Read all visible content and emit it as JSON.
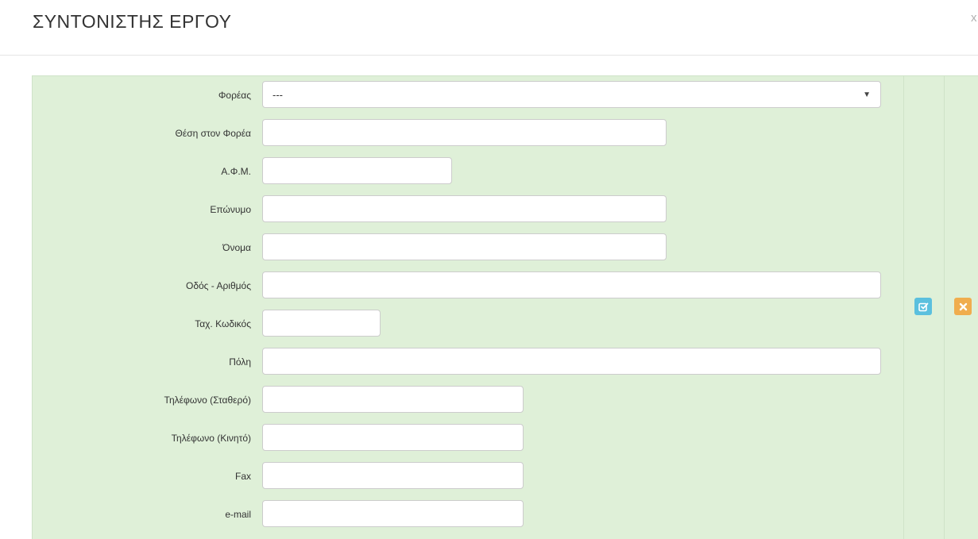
{
  "modal": {
    "title": "ΣΥΝΤΟΝΙΣΤΗΣ ΕΡΓΟΥ",
    "close_label": "x"
  },
  "form": {
    "foreas": {
      "label": "Φορέας",
      "selected": "---"
    },
    "thesi": {
      "label": "Θέση στον Φορέα",
      "value": ""
    },
    "afm": {
      "label": "Α.Φ.Μ.",
      "value": ""
    },
    "eponymo": {
      "label": "Επώνυμο",
      "value": ""
    },
    "onoma": {
      "label": "Όνομα",
      "value": ""
    },
    "odos": {
      "label": "Οδός - Αριθμός",
      "value": ""
    },
    "tk": {
      "label": "Ταχ. Κωδικός",
      "value": ""
    },
    "poli": {
      "label": "Πόλη",
      "value": ""
    },
    "tilefono_stathero": {
      "label": "Τηλέφωνο (Σταθερό)",
      "value": ""
    },
    "tilefono_kinito": {
      "label": "Τηλέφωνο (Κινητό)",
      "value": ""
    },
    "fax": {
      "label": "Fax",
      "value": ""
    },
    "email": {
      "label": "e-mail",
      "value": ""
    }
  },
  "actions": {
    "edit_icon": "edit-icon",
    "delete_icon": "times-icon",
    "edit_color": "#5bc0de",
    "delete_color": "#f0ad4e"
  },
  "colors": {
    "panel_background": "#dff0d8"
  }
}
